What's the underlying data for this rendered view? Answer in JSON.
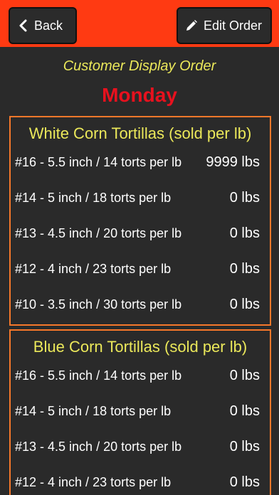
{
  "toolbar": {
    "back_label": "Back",
    "edit_label": "Edit Order",
    "bar_color": "#ff3a12"
  },
  "header": {
    "subtitle": "Customer Display Order",
    "day": "Monday"
  },
  "sections": [
    {
      "title": "White Corn Tortillas (sold per lb)",
      "items": [
        {
          "name": "#16 - 5.5 inch / 14 torts per lb",
          "qty": "9999 lbs"
        },
        {
          "name": "#14 - 5 inch / 18 torts per lb",
          "qty": "0 lbs"
        },
        {
          "name": "#13 - 4.5 inch / 20 torts per lb",
          "qty": "0 lbs"
        },
        {
          "name": "#12 - 4 inch / 23 torts per lb",
          "qty": "0 lbs"
        },
        {
          "name": "#10 - 3.5 inch / 30 torts per lb",
          "qty": "0 lbs"
        }
      ]
    },
    {
      "title": "Blue Corn Tortillas (sold per lb)",
      "items": [
        {
          "name": "#16 - 5.5 inch / 14 torts per lb",
          "qty": "0 lbs"
        },
        {
          "name": "#14 - 5 inch / 18 torts per lb",
          "qty": "0 lbs"
        },
        {
          "name": "#13 - 4.5 inch / 20 torts per lb",
          "qty": "0 lbs"
        },
        {
          "name": "#12 - 4 inch / 23 torts per lb",
          "qty": "0 lbs"
        }
      ]
    }
  ],
  "icons": {
    "back": "chevron-left-icon",
    "edit": "pencil-icon"
  },
  "colors": {
    "accent_orange": "#f6782a",
    "title_yellow": "#ebe85a",
    "day_red": "#e8111e",
    "background": "#2a2a2a"
  }
}
